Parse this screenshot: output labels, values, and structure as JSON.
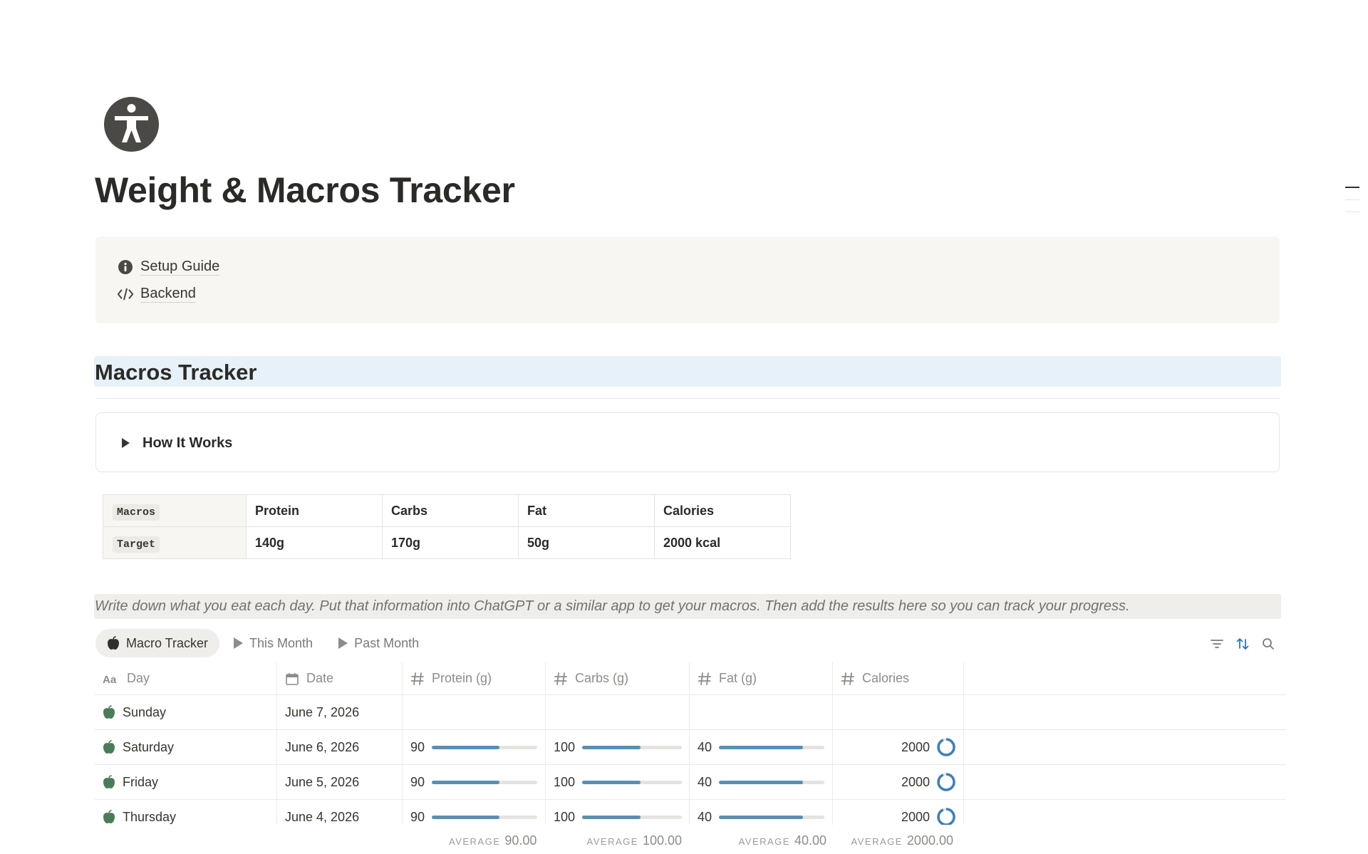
{
  "page": {
    "icon": "accessibility-person-icon",
    "title": "Weight & Macros Tracker"
  },
  "callout": {
    "links": [
      {
        "label": "Setup Guide",
        "icon": "info-icon"
      },
      {
        "label": "Backend",
        "icon": "code-icon"
      }
    ]
  },
  "section": {
    "heading": "Macros Tracker",
    "toggle_label": "How It Works"
  },
  "macros_table": {
    "rows": [
      {
        "label": "Macros",
        "protein": "Protein",
        "carbs": "Carbs",
        "fat": "Fat",
        "calories": "Calories"
      },
      {
        "label": "Target",
        "protein": "140g",
        "carbs": "170g",
        "fat": "50g",
        "calories": "2000 kcal"
      }
    ]
  },
  "quote": "Write down what you eat each day. Put that information into ChatGPT or a similar app to get your macros. Then add the results here so you can track your progress.",
  "views": [
    {
      "label": "Macro Tracker",
      "icon": "apple-icon",
      "active": true
    },
    {
      "label": "This Month",
      "icon": "play-icon",
      "active": false
    },
    {
      "label": "Past Month",
      "icon": "play-icon",
      "active": false
    }
  ],
  "toolbar": {
    "icons": [
      "filter-icon",
      "sort-icon",
      "search-icon"
    ]
  },
  "columns": [
    {
      "label": "Day",
      "icon": "text-property-icon"
    },
    {
      "label": "Date",
      "icon": "calendar-icon"
    },
    {
      "label": "Protein (g)",
      "icon": "number-icon"
    },
    {
      "label": "Carbs (g)",
      "icon": "number-icon"
    },
    {
      "label": "Fat (g)",
      "icon": "number-icon"
    },
    {
      "label": "Calories",
      "icon": "number-icon"
    }
  ],
  "rows": [
    {
      "day": "Sunday",
      "date": "June 7, 2026",
      "protein": "",
      "carbs": "",
      "fat": "",
      "calories": ""
    },
    {
      "day": "Saturday",
      "date": "June 6, 2026",
      "protein": "90",
      "carbs": "100",
      "fat": "40",
      "calories": "2000"
    },
    {
      "day": "Friday",
      "date": "June 5, 2026",
      "protein": "90",
      "carbs": "100",
      "fat": "40",
      "calories": "2000"
    },
    {
      "day": "Thursday",
      "date": "June 4, 2026",
      "protein": "90",
      "carbs": "100",
      "fat": "40",
      "calories": "2000"
    }
  ],
  "progress": {
    "protein": 0.643,
    "carbs": 0.588,
    "fat": 0.8,
    "calories": 1.0
  },
  "averages": {
    "label": "AVERAGE",
    "protein": "90.00",
    "carbs": "100.00",
    "fat": "40.00",
    "calories": "2000.00"
  },
  "colors": {
    "accent": "#5a8fb4",
    "ring": "#3d7fba",
    "apple": "#4a7c59",
    "heading_bg": "#e7f1f9"
  }
}
